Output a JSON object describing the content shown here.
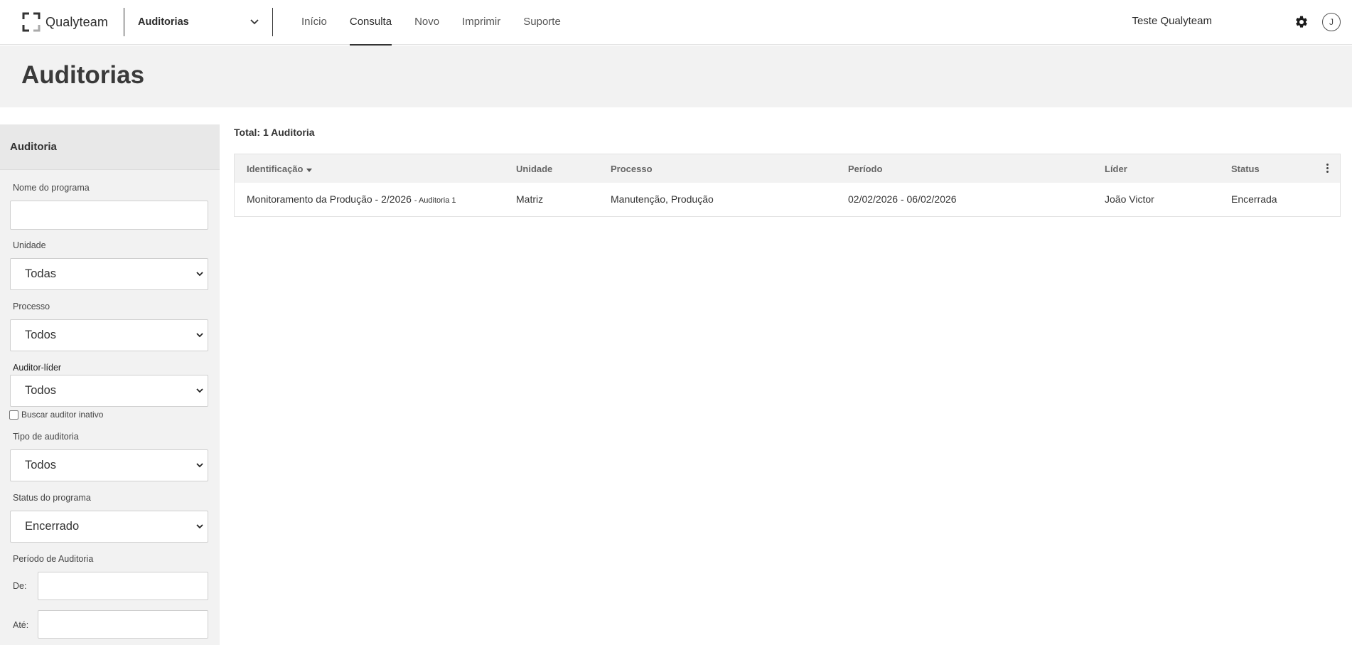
{
  "app": {
    "logo_text": "Qualyteam",
    "module": "Auditorias"
  },
  "nav": [
    {
      "label": "Início",
      "active": false
    },
    {
      "label": "Consulta",
      "active": true
    },
    {
      "label": "Novo",
      "active": false
    },
    {
      "label": "Imprimir",
      "active": false
    },
    {
      "label": "Suporte",
      "active": false
    }
  ],
  "user": {
    "name": "Teste Qualyteam",
    "avatar_initial": "J"
  },
  "page": {
    "title": "Auditorias"
  },
  "filters": {
    "heading": "Auditoria",
    "program_name": {
      "label": "Nome do programa",
      "value": ""
    },
    "unit": {
      "label": "Unidade",
      "value": "Todas"
    },
    "process": {
      "label": "Processo",
      "value": "Todos"
    },
    "lead_auditor": {
      "label": "Auditor-líder",
      "value": "Todos"
    },
    "inactive_auditor": {
      "label": "Buscar auditor inativo",
      "checked": false
    },
    "audit_type": {
      "label": "Tipo de auditoria",
      "value": "Todos"
    },
    "program_status": {
      "label": "Status do programa",
      "value": "Encerrado"
    },
    "period": {
      "label": "Período de Auditoria",
      "from_label": "De:",
      "to_label": "Até:",
      "from": "",
      "to": ""
    }
  },
  "results": {
    "total": "Total: 1 Auditoria",
    "columns": [
      "Identificação",
      "Unidade",
      "Processo",
      "Período",
      "Líder",
      "Status"
    ],
    "rows": [
      {
        "identification": "Monitoramento da Produção - 2/2026",
        "identification_sub": "- Auditoria 1",
        "unit": "Matriz",
        "process": "Manutenção, Produção",
        "period": "02/02/2026 - 06/02/2026",
        "leader": "João Victor",
        "status": "Encerrada"
      }
    ]
  },
  "icons": {
    "logo": "bracket-logo-icon",
    "module_chevron": "chevron-down-icon",
    "settings": "gear-icon",
    "sort": "sort-down-icon",
    "column_menu": "kebab-menu-icon",
    "select_chevron": "chevron-down-icon"
  }
}
